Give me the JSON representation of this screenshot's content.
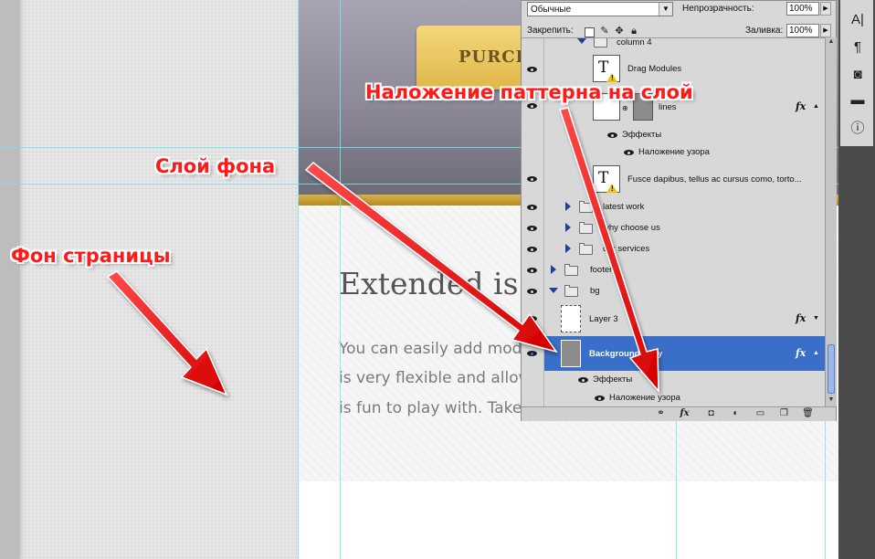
{
  "canvas": {
    "purchase_button": "PURCH",
    "heading": "Extended is",
    "paragraph_lines": [
      "You can easily add mod",
      "is very flexible and allow",
      "is fun to play with. Take"
    ]
  },
  "layers_panel": {
    "blend_mode": "Обычные",
    "opacity_label": "Непрозрачность:",
    "opacity_value": "100%",
    "lock_label": "Закрепить:",
    "fill_label": "Заливка:",
    "fill_value": "100%",
    "rows": [
      {
        "name": "column 4",
        "kind": "group-open"
      },
      {
        "name": "Drag Modules",
        "kind": "text"
      },
      {
        "name": "lines",
        "kind": "smart-fx"
      },
      {
        "name": "Эффекты",
        "kind": "effects"
      },
      {
        "name": "Наложение узора",
        "kind": "effect"
      },
      {
        "name": "Fusce dapibus, tellus ac cursus como, torto...",
        "kind": "text"
      },
      {
        "name": "latest work",
        "kind": "group"
      },
      {
        "name": "why choose us",
        "kind": "group"
      },
      {
        "name": "our services",
        "kind": "group"
      },
      {
        "name": "footer",
        "kind": "group"
      },
      {
        "name": "bg",
        "kind": "group-open"
      },
      {
        "name": "Layer 3",
        "kind": "layer-fx"
      },
      {
        "name": "Background copy",
        "kind": "layer-fx-selected"
      },
      {
        "name": "Эффекты",
        "kind": "effects"
      },
      {
        "name": "Наложение узора",
        "kind": "effect"
      }
    ],
    "fx_label": "fx"
  },
  "annotations": {
    "page_background": "Фон страницы",
    "background_layer": "Слой фона",
    "pattern_overlay": "Наложение паттерна на слой"
  },
  "tool_strip_icons": [
    "character-icon",
    "paragraph-icon",
    "clone-source-icon",
    "tool-presets-icon",
    "info-icon"
  ],
  "colors": {
    "selected_row": "#3a6fc9",
    "guides": "#6ee8f0",
    "annotation": "#ff1a1a"
  }
}
